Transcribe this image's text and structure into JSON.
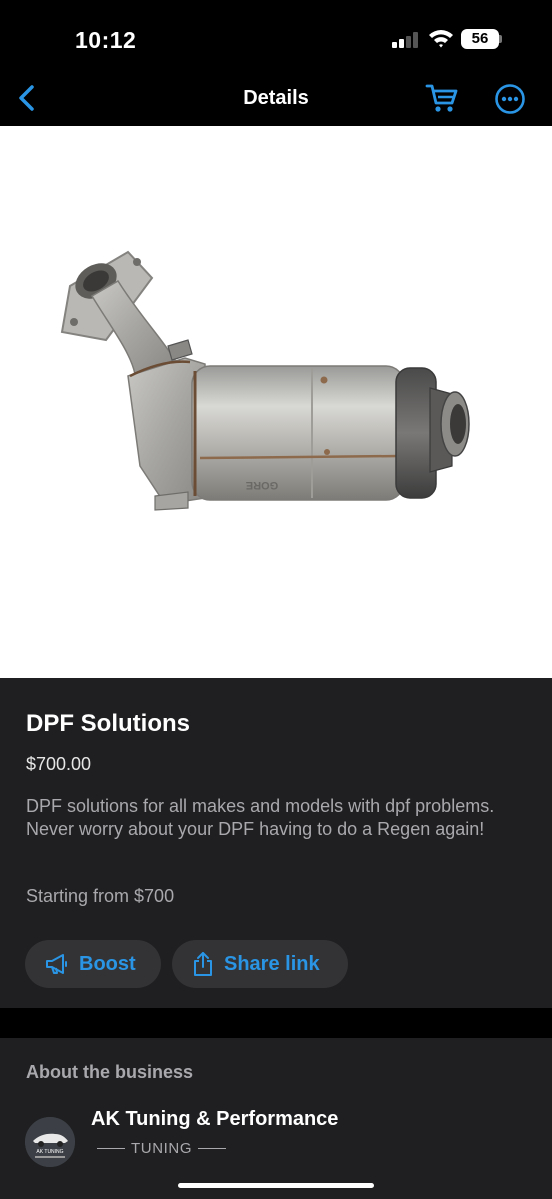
{
  "status_bar": {
    "time": "10:12",
    "battery": "56",
    "signal_bars_active": 2,
    "signal_bars_total": 4
  },
  "nav": {
    "title": "Details",
    "back_icon": "chevron-left-icon",
    "cart_icon": "shopping-cart-icon",
    "more_icon": "more-options-icon",
    "accent_color": "#2a95e4"
  },
  "product": {
    "image_subject": "diesel particulate filter exhaust part",
    "title": "DPF Solutions",
    "price": "$700.00",
    "description": "DPF solutions for all makes and models with dpf problems. Never worry about your DPF having to do a Regen again!",
    "starting_from": "Starting from $700",
    "part_marking": "GORE",
    "buttons": {
      "boost": "Boost",
      "share": "Share link",
      "boost_icon": "megaphone-icon",
      "share_icon": "share-icon"
    }
  },
  "about": {
    "heading": "About the business",
    "business_name": "AK Tuning & Performance",
    "business_tag": "TUNING",
    "avatar_logo_text": "AK TUNING"
  },
  "colors": {
    "background": "#000000",
    "card": "#1f1f21",
    "button": "#333336",
    "accent": "#2a95e4",
    "muted_text": "#a9a9ad"
  }
}
